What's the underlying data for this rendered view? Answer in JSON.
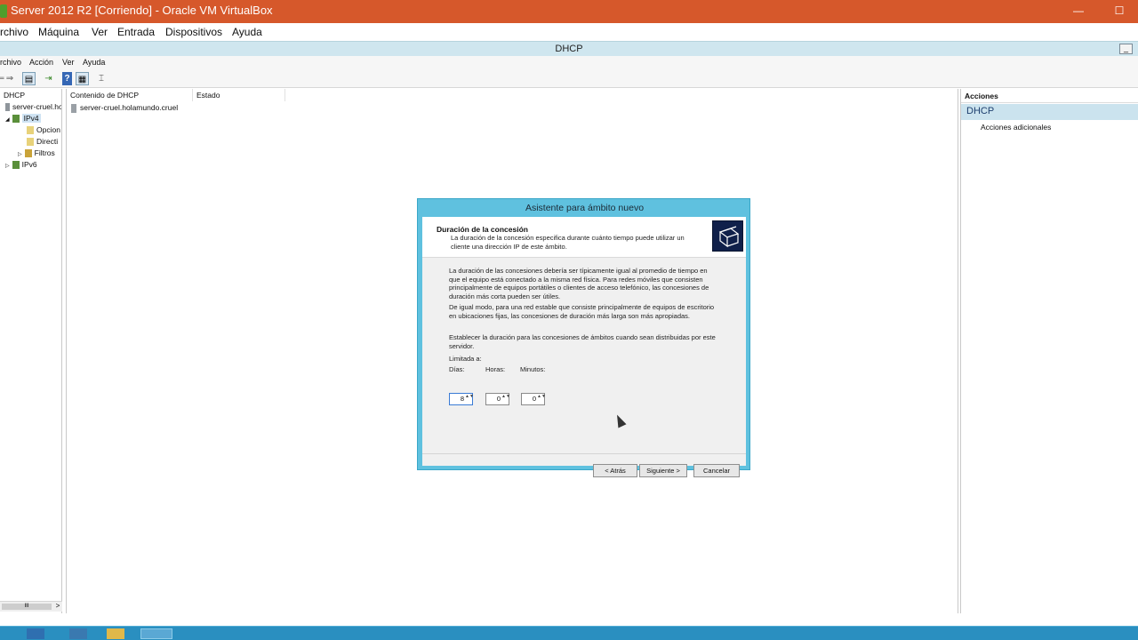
{
  "vbox": {
    "title": "Server 2012 R2 [Corriendo] - Oracle VM VirtualBox",
    "menu": [
      "rchivo",
      "Máquina",
      "Ver",
      "Entrada",
      "Dispositivos",
      "Ayuda"
    ],
    "minimize": "—",
    "maximize": "☐"
  },
  "mmc": {
    "title": "DHCP",
    "minimize": "_",
    "menu": [
      "rchivo",
      "Acción",
      "Ver",
      "Ayuda"
    ],
    "toolbar": [
      "⇐",
      "⇒",
      "▤",
      "⇥",
      "?",
      "▦",
      "⌶"
    ],
    "tree": [
      {
        "label": "DHCP"
      },
      {
        "label": "server-cruel.ho"
      },
      {
        "label": "IPv4"
      },
      {
        "label": "Opcion"
      },
      {
        "label": "Directi"
      },
      {
        "label": "Filtros"
      },
      {
        "label": "IPv6"
      }
    ],
    "tree_expanders": {
      "ipv4": "◢",
      "filtros": "▷",
      "ipv6": "▷"
    },
    "tree_scroll": {
      "thumb": "III",
      "right_arrow": ">"
    },
    "content": {
      "columns": [
        "Contenido de DHCP",
        "Estado"
      ],
      "rows": [
        {
          "name": "server-cruel.holamundo.cruel",
          "status": ""
        }
      ]
    },
    "actions": {
      "header": "Acciones",
      "section": "DHCP",
      "items": [
        "Acciones adicionales"
      ]
    }
  },
  "wizard": {
    "title": "Asistente para ámbito nuevo",
    "heading": "Duración de la concesión",
    "subheading": "La duración de la concesión especifica durante cuánto tiempo puede utilizar un cliente una dirección IP de este ámbito.",
    "para1": "La duración de las concesiones debería ser típicamente igual al promedio de tiempo en que el equipo está conectado a la misma red física. Para redes móviles que consisten principalmente de equipos portátiles o clientes de acceso telefónico, las concesiones de duración más corta pueden ser útiles.",
    "para2": "De igual modo, para una red estable que consiste principalmente de equipos de escritorio en ubicaciones fijas, las concesiones de duración más larga son más apropiadas.",
    "para3": "Establecer la duración para las concesiones de ámbitos cuando sean distribuidas por este servidor.",
    "limit_label": "Limitada a:",
    "fields": [
      {
        "label": "Días:",
        "value": "8"
      },
      {
        "label": "Horas:",
        "value": "0"
      },
      {
        "label": "Minutos:",
        "value": "0"
      }
    ],
    "spin_arrows": "▲▼",
    "buttons": {
      "back": "< Atrás",
      "next": "Siguiente >",
      "cancel": "Cancelar"
    }
  }
}
